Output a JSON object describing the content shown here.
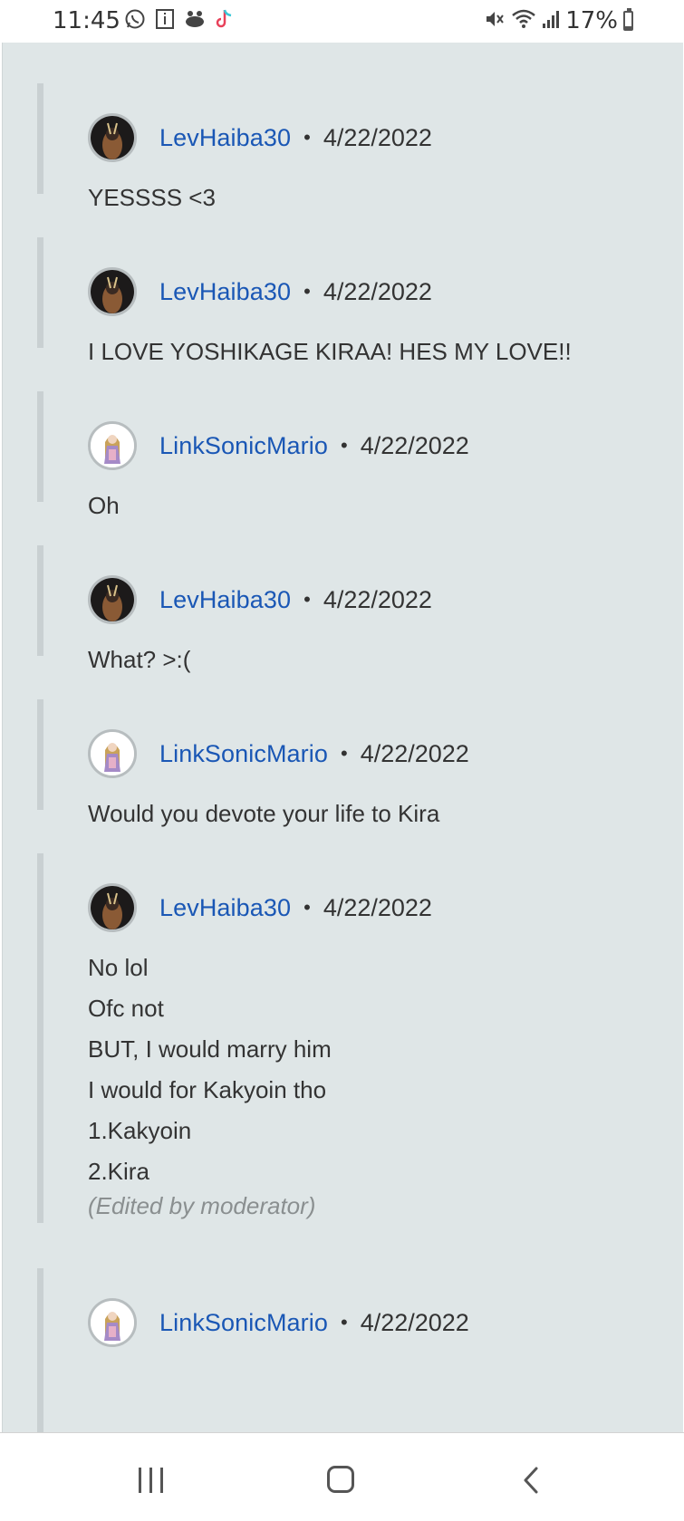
{
  "status_bar": {
    "time": "11:45",
    "left_icons": [
      "whatsapp-icon",
      "info-icon",
      "app-icon",
      "tiktok-icon"
    ],
    "right_icons": [
      "mute-icon",
      "wifi-icon",
      "signal-icon"
    ],
    "battery_text": "17%",
    "battery_level": 0.17
  },
  "comments": [
    {
      "username": "LevHaiba30",
      "separator": "•",
      "date": "4/22/2022",
      "avatar": "lev-avatar",
      "lines": [
        "YESSSS <3"
      ]
    },
    {
      "username": "LevHaiba30",
      "separator": "•",
      "date": "4/22/2022",
      "avatar": "lev-avatar",
      "lines": [
        "I LOVE YOSHIKAGE KIRAA! HES MY LOVE!!"
      ]
    },
    {
      "username": "LinkSonicMario",
      "separator": "•",
      "date": "4/22/2022",
      "avatar": "link-avatar",
      "lines": [
        "Oh"
      ]
    },
    {
      "username": "LevHaiba30",
      "separator": "•",
      "date": "4/22/2022",
      "avatar": "lev-avatar",
      "lines": [
        "What? >:("
      ]
    },
    {
      "username": "LinkSonicMario",
      "separator": "•",
      "date": "4/22/2022",
      "avatar": "link-avatar",
      "lines": [
        "Would you devote your life to Kira"
      ]
    },
    {
      "username": "LevHaiba30",
      "separator": "•",
      "date": "4/22/2022",
      "avatar": "lev-avatar",
      "lines": [
        "No lol",
        "Ofc not",
        "BUT, I would marry him",
        "I would for Kakyoin tho",
        "1.Kakyoin",
        "2.Kira"
      ],
      "edited_note": "(Edited by moderator)"
    },
    {
      "username": "LinkSonicMario",
      "separator": "•",
      "date": "4/22/2022",
      "avatar": "link-avatar",
      "lines": []
    }
  ],
  "nav_bar": {
    "buttons": [
      "recent-apps",
      "home",
      "back"
    ]
  }
}
